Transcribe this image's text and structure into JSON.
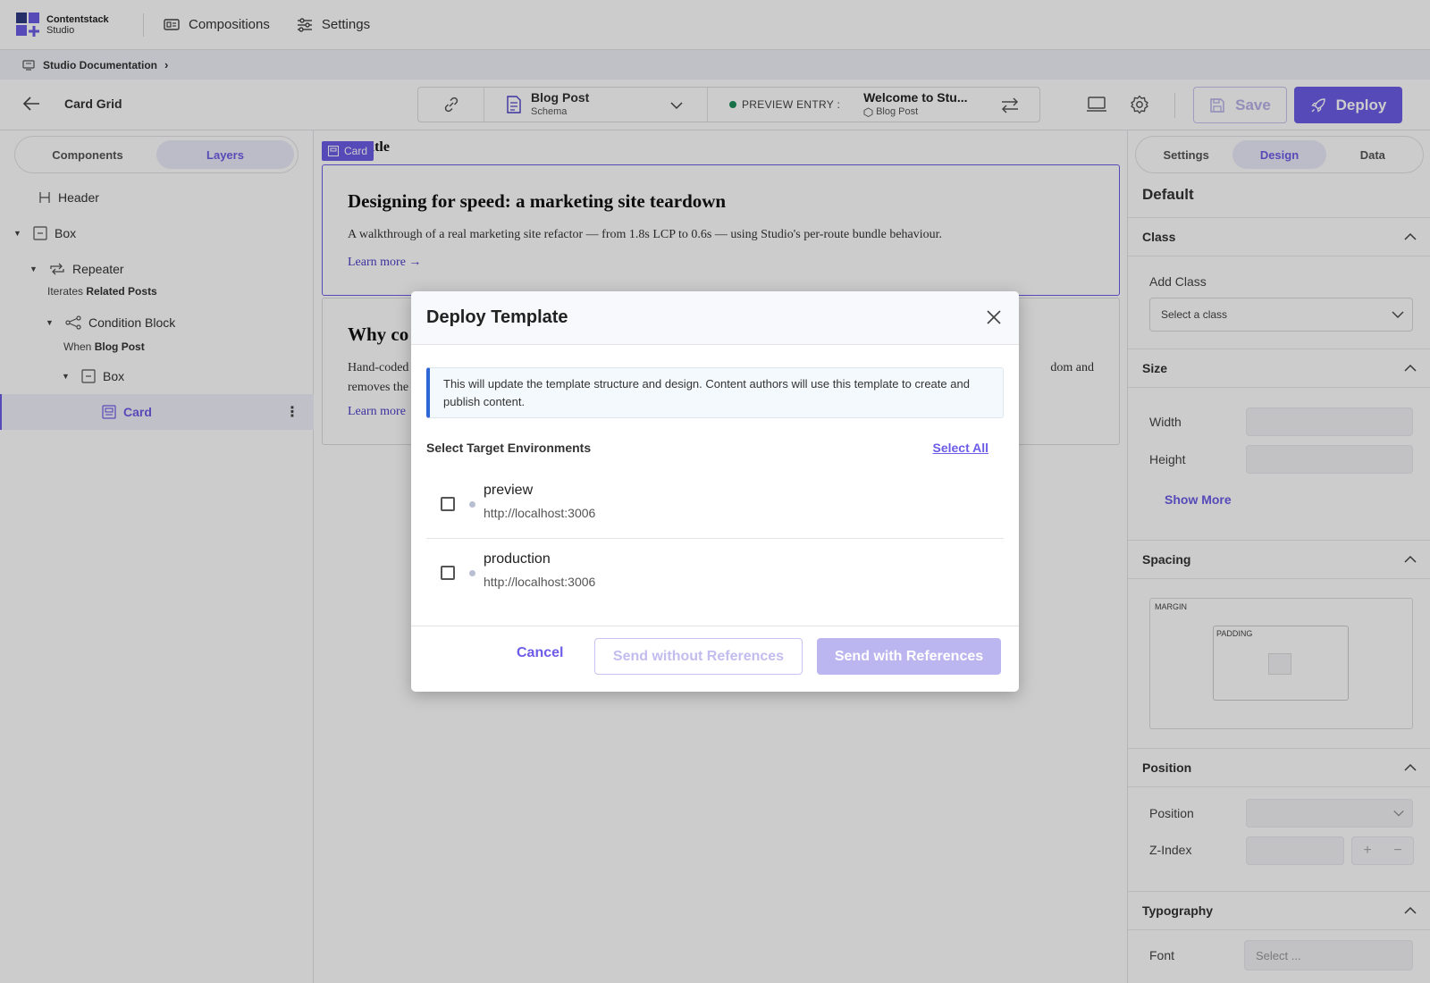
{
  "brand": {
    "name": "Contentstack",
    "product": "Studio"
  },
  "topnav": {
    "items": [
      {
        "label": "Compositions"
      },
      {
        "label": "Settings"
      }
    ]
  },
  "breadcrumb": {
    "label": "Studio Documentation"
  },
  "toolbar": {
    "page_title": "Card Grid",
    "schema": {
      "name": "Blog Post",
      "type": "Schema"
    },
    "preview": {
      "label": "PREVIEW ENTRY :",
      "title": "Welcome to Stu...",
      "content_type": "Blog Post"
    },
    "save_label": "Save",
    "deploy_label": "Deploy"
  },
  "left_panel": {
    "tabs": [
      {
        "label": "Components"
      },
      {
        "label": "Layers"
      }
    ],
    "tree": {
      "header": "Header",
      "box1": "Box",
      "repeater": "Repeater",
      "repeater_sub_prefix": "Iterates",
      "repeater_sub_value": "Related Posts",
      "condition": "Condition Block",
      "condition_sub_prefix": "When",
      "condition_sub_value": "Blog Post",
      "box2": "Box",
      "card": "Card"
    }
  },
  "canvas": {
    "tag_label": "Card",
    "partial_title": "Card Title",
    "cards": [
      {
        "title": "Designing for speed: a marketing site teardown",
        "body": "A walkthrough of a real marketing site refactor — from 1.8s LCP to 0.6s — using Studio's per-route bundle behaviour.",
        "link": "Learn more →"
      },
      {
        "title": "Why co",
        "body_left": "Hand-coded",
        "body_right": "dom and",
        "body_line2": "removes the",
        "link": "Learn more →"
      }
    ]
  },
  "right_panel": {
    "tabs": [
      {
        "label": "Settings"
      },
      {
        "label": "Design"
      },
      {
        "label": "Data"
      }
    ],
    "default_label": "Default",
    "sections": {
      "class": "Class",
      "size": "Size",
      "spacing": "Spacing",
      "position": "Position",
      "typography": "Typography"
    },
    "add_class_label": "Add Class",
    "class_placeholder": "Select a class",
    "width_label": "Width",
    "height_label": "Height",
    "show_more": "Show More",
    "margin_label": "MARGIN",
    "padding_label": "PADDING",
    "position_label": "Position",
    "zindex_label": "Z-Index",
    "font_label": "Font",
    "font_placeholder": "Select ..."
  },
  "modal": {
    "title": "Deploy Template",
    "notice": "This will update the template structure and design. Content authors will use this template to create and publish content.",
    "env_heading": "Select Target Environments",
    "select_all": "Select All",
    "environments": [
      {
        "name": "preview",
        "url": "http://localhost:3006",
        "checked": false
      },
      {
        "name": "production",
        "url": "http://localhost:3006",
        "checked": false
      }
    ],
    "cancel_label": "Cancel",
    "send_without_label": "Send without References",
    "send_with_label": "Send with References"
  },
  "colors": {
    "accent": "#6c5ce7",
    "notice_border": "#2e66d6",
    "status_green": "#1e8e5a"
  }
}
